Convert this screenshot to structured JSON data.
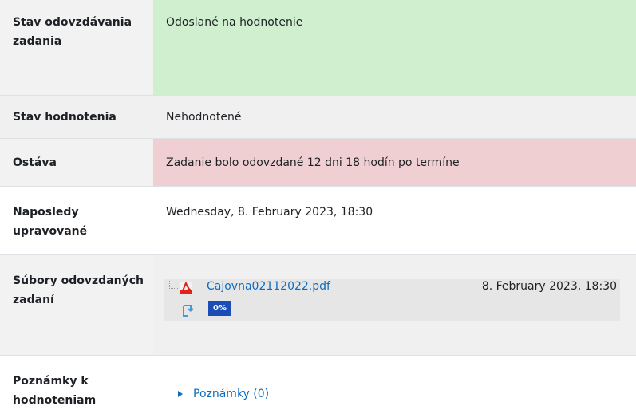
{
  "rows": {
    "submission_status": {
      "label": "Stav odovzdávania zadania",
      "value": "Odoslané na hodnotenie"
    },
    "grading_status": {
      "label": "Stav hodnotenia",
      "value": "Nehodnotené"
    },
    "time_remaining": {
      "label": "Ostáva",
      "value": "Zadanie bolo odovzdané 12 dni 18 hodín po termíne"
    },
    "last_modified": {
      "label": "Naposledy upravované",
      "value": "Wednesday, 8. February 2023, 18:30"
    },
    "file_submissions": {
      "label": "Súbory odovzdaných zadaní",
      "file": {
        "name": "Cajovna02112022.pdf",
        "date": "8. February 2023, 18:30",
        "score": "0%"
      }
    },
    "submission_comments": {
      "label": "Poznámky k hodnoteniam",
      "link": "Poznámky (0)"
    }
  },
  "colors": {
    "submitted": "#cfefcf",
    "overdue": "#efcfd1",
    "neutral": "#f0f0f0",
    "link": "#0f6cbf",
    "badge": "#1b4db8"
  },
  "icons": {
    "file_type": "pdf-icon",
    "plagiarism": "plagiarism-check-icon",
    "comments_toggle": "caret-right-icon"
  }
}
